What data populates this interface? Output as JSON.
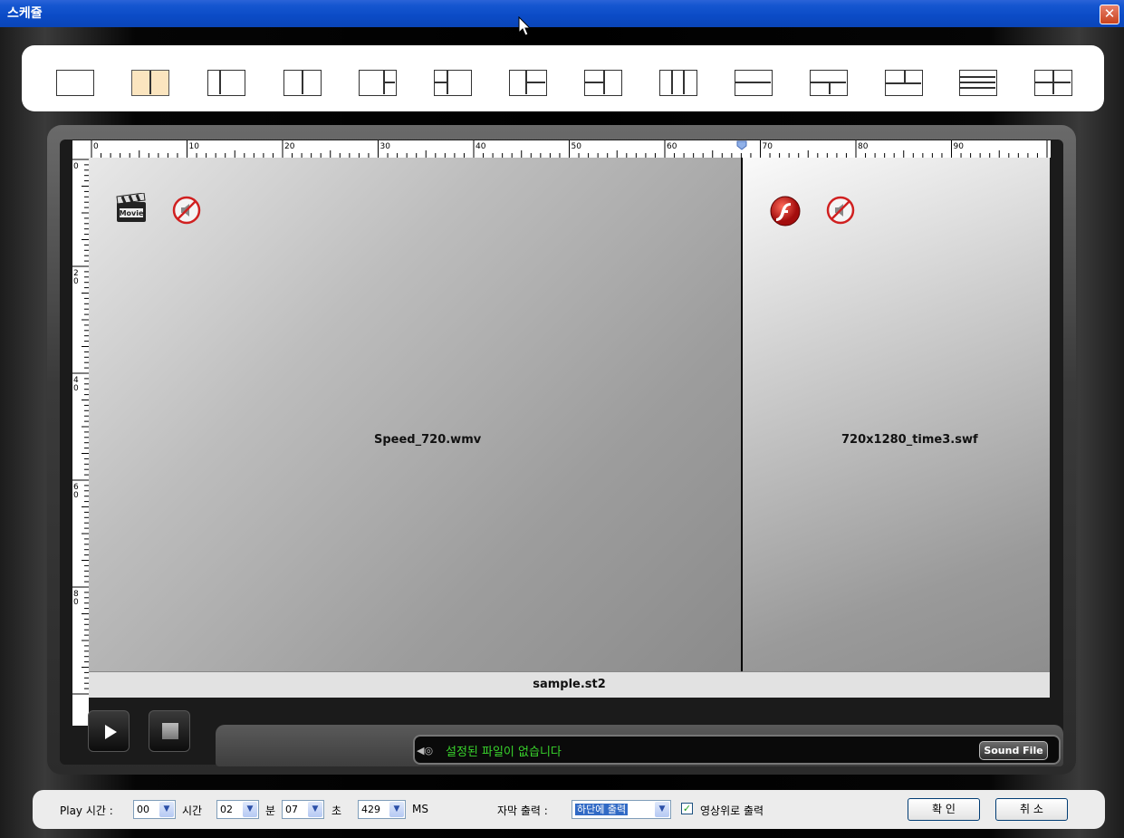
{
  "window": {
    "title": "스케쥴",
    "close_glyph": "✕"
  },
  "layouts": [
    {
      "name": "single"
    },
    {
      "name": "split-2-vertical"
    },
    {
      "name": "split-left-narrow"
    },
    {
      "name": "split-left-wide"
    },
    {
      "name": "right-split"
    },
    {
      "name": "left-split"
    },
    {
      "name": "left-double"
    },
    {
      "name": "cross-left"
    },
    {
      "name": "three-columns"
    },
    {
      "name": "two-rows"
    },
    {
      "name": "bottom-split"
    },
    {
      "name": "top-split"
    },
    {
      "name": "four-rows"
    },
    {
      "name": "quad"
    }
  ],
  "ruler": {
    "h_labels": [
      "0",
      "10",
      "20",
      "30",
      "40",
      "50",
      "60",
      "70",
      "80",
      "90"
    ],
    "v_labels": [
      "0",
      "2\n0",
      "4\n0",
      "6\n0",
      "8\n0"
    ]
  },
  "zones": {
    "left_file": "Speed_720.wmv",
    "right_file": "720x1280_time3.swf",
    "left_badge": "Movie"
  },
  "schedule_file": "sample.st2",
  "sound": {
    "status": "설정된 파일이 없습니다",
    "button": "Sound File",
    "icon_glyph": "◀◎"
  },
  "bottom": {
    "play_time_label": "Play 시간 :",
    "hours": "00",
    "hours_unit": "시간",
    "minutes": "02",
    "minutes_unit": "분",
    "seconds": "07",
    "seconds_unit": "초",
    "ms": "429",
    "ms_unit": "MS",
    "subtitle_label": "자막 출력 :",
    "subtitle_value": "하단에 출력",
    "overlay_label": "영상위로 출력",
    "overlay_checked": "✓",
    "ok_button": "확 인",
    "cancel_button": "취 소"
  },
  "colors": {
    "title_blue": "#0b4bc6",
    "selected_layout": "#fbe5bf",
    "sound_text": "#39d42c"
  }
}
